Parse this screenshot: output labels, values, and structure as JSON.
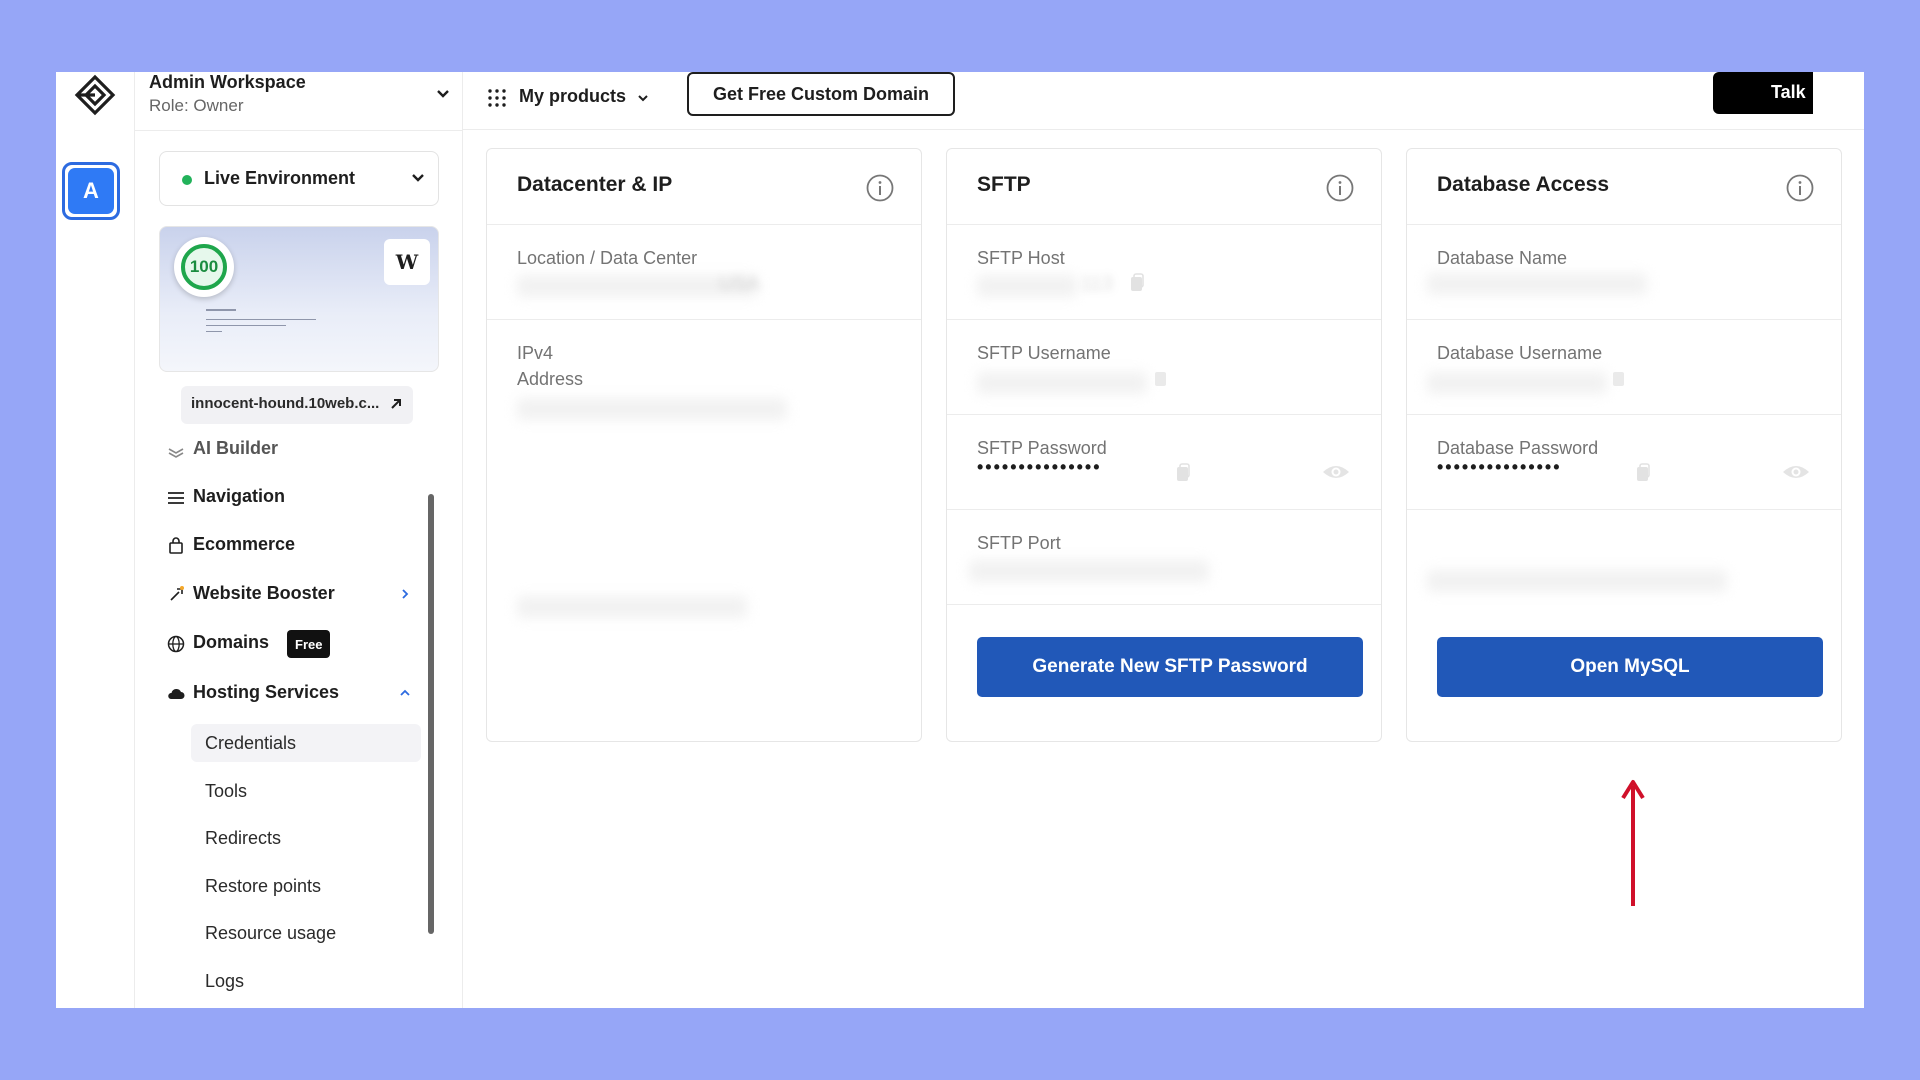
{
  "workspace": {
    "name": "Admin Workspace",
    "role": "Role: Owner",
    "avatar_letter": "A"
  },
  "environment": {
    "label": "Live Environment",
    "status_color": "#22b25a"
  },
  "site": {
    "score": "100",
    "url": "innocent-hound.10web.c...",
    "wp_letter": "W"
  },
  "nav": {
    "items": [
      {
        "label": "AI Builder",
        "icon": "layers-icon"
      },
      {
        "label": "Navigation",
        "icon": "menu-icon"
      },
      {
        "label": "Ecommerce",
        "icon": "shopping-bag-icon"
      },
      {
        "label": "Website Booster",
        "icon": "rocket-icon"
      },
      {
        "label": "Domains",
        "icon": "globe-icon",
        "badge": "Free"
      },
      {
        "label": "Hosting Services",
        "icon": "cloud-icon"
      }
    ],
    "hosting_sub": [
      "Credentials",
      "Tools",
      "Redirects",
      "Restore points",
      "Resource usage",
      "Logs"
    ]
  },
  "topbar": {
    "products_label": "My products",
    "domain_button": "Get Free Custom Domain",
    "talk_label": "Talk"
  },
  "cards": {
    "datacenter": {
      "title": "Datacenter & IP",
      "location_label": "Location / Data Center",
      "location_value": "USA",
      "ipv4_label": "IPv4 Address"
    },
    "sftp": {
      "title": "SFTP",
      "host_label": "SFTP Host",
      "host_value": "113",
      "username_label": "SFTP Username",
      "password_label": "SFTP Password",
      "password_mask": "•••••••••••••••",
      "port_label": "SFTP Port",
      "button": "Generate New SFTP Password"
    },
    "database": {
      "title": "Database Access",
      "name_label": "Database Name",
      "username_label": "Database Username",
      "password_label": "Database Password",
      "password_mask": "•••••••••••••••",
      "button": "Open MySQL"
    }
  },
  "colors": {
    "background": "#96a6f7",
    "primary": "#2158b8",
    "annotation_arrow": "#d0102a",
    "accent": "#2f7af5"
  }
}
